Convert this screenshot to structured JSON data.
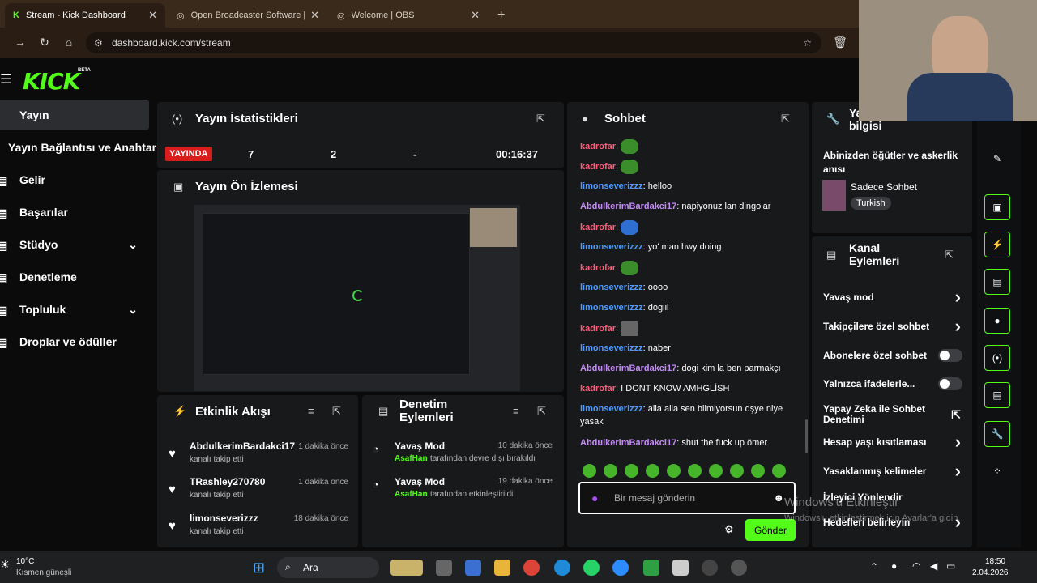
{
  "browser": {
    "tabs": [
      {
        "title": "Stream - Kick Dashboard",
        "active": true
      },
      {
        "title": "Open Broadcaster Software | OB",
        "active": false
      },
      {
        "title": "Welcome | OBS",
        "active": false
      }
    ],
    "url": "dashboard.kick.com/stream"
  },
  "header": {
    "logo": "KICK",
    "badge": "BETA"
  },
  "sidebar": {
    "items": [
      {
        "label": "Yayın",
        "active": true
      },
      {
        "label": "Yayın Bağlantısı ve Anahtarı"
      },
      {
        "label": "Gelir"
      },
      {
        "label": "Başarılar"
      },
      {
        "label": "Stüdyo",
        "expandable": true
      },
      {
        "label": "Denetleme"
      },
      {
        "label": "Topluluk",
        "expandable": true
      },
      {
        "label": "Droplar ve ödüller"
      }
    ]
  },
  "stats": {
    "title": "Yayın İstatistikleri",
    "live_label": "YAYINDA",
    "viewers": "7",
    "followers": "2",
    "subs": "-",
    "duration": "00:16:37"
  },
  "preview": {
    "title": "Yayın Ön İzlemesi"
  },
  "activity": {
    "title": "Etkinlik Akışı",
    "items": [
      {
        "name": "AbdulkerimBardakci17",
        "action": "kanalı takip etti",
        "time": "1 dakika önce"
      },
      {
        "name": "TRashley270780",
        "action": "kanalı takip etti",
        "time": "1 dakika önce"
      },
      {
        "name": "limonseverizzz",
        "action": "kanalı takip etti",
        "time": "18 dakika önce"
      }
    ]
  },
  "moderation": {
    "title": "Denetim Eylemleri",
    "items": [
      {
        "title": "Yavaş Mod",
        "user": "AsafHan",
        "action": "tarafından devre dışı bırakıldı",
        "time": "10 dakika önce"
      },
      {
        "title": "Yavaş Mod",
        "user": "AsafHan",
        "action": "tarafından etkinleştirildi",
        "time": "19 dakika önce"
      }
    ]
  },
  "chat": {
    "title": "Sohbet",
    "messages": [
      {
        "user": "kadrofar",
        "color": "red",
        "text": "",
        "emote": "green"
      },
      {
        "user": "kadrofar",
        "color": "red",
        "text": "",
        "emote": "green"
      },
      {
        "user": "limonseverizzz",
        "color": "blue",
        "text": "helloo"
      },
      {
        "user": "AbdulkerimBardakci17",
        "color": "purple",
        "text": "napiyonuz lan dingolar"
      },
      {
        "user": "kadrofar",
        "color": "red",
        "text": "",
        "emote": "blue"
      },
      {
        "user": "limonseverizzz",
        "color": "blue",
        "text": "yo' man hwy doing"
      },
      {
        "user": "kadrofar",
        "color": "red",
        "text": "",
        "emote": "green"
      },
      {
        "user": "limonseverizzz",
        "color": "blue",
        "text": "oooo"
      },
      {
        "user": "limonseverizzz",
        "color": "blue",
        "text": "dogiil"
      },
      {
        "user": "kadrofar",
        "color": "red",
        "text": "",
        "emote": "gray"
      },
      {
        "user": "limonseverizzz",
        "color": "blue",
        "text": "naber"
      },
      {
        "user": "AbdulkerimBardakci17",
        "color": "purple",
        "text": "dogi kim la ben parmakçı"
      },
      {
        "user": "kadrofar",
        "color": "red",
        "text": "I DONT KNOW AMHGLİSH"
      },
      {
        "user": "limonseverizzz",
        "color": "blue",
        "text": "alla alla sen bilmiyorsun dşye niye yasak"
      },
      {
        "user": "AbdulkerimBardakci17",
        "color": "purple",
        "text": "shut the fuck up ömer"
      }
    ],
    "input_placeholder": "Bir mesaj gönderin",
    "send_label": "Gönder"
  },
  "stream_info": {
    "title_line1": "Yayın",
    "title_line2": "bilgisi",
    "stream_title": "Abinizden öğütler ve askerlik anısı",
    "category": "Sadece Sohbet",
    "language": "Turkish"
  },
  "channel_actions": {
    "title_line1": "Kanal",
    "title_line2": "Eylemleri",
    "items": [
      {
        "label": "Yavaş mod",
        "type": "arrow"
      },
      {
        "label": "Takipçilere özel sohbet",
        "type": "arrow"
      },
      {
        "label": "Abonelere özel sohbet",
        "type": "toggle"
      },
      {
        "label": "Yalnızca ifadelerle...",
        "type": "toggle"
      },
      {
        "label": "Yapay Zeka ile Sohbet Denetimi",
        "type": "external"
      },
      {
        "label": "Hesap yaşı kısıtlaması",
        "type": "arrow"
      },
      {
        "label": "Yasaklanmış kelimeler",
        "type": "arrow"
      },
      {
        "label": "İzleyici Yönlendir",
        "type": "none"
      },
      {
        "label": "Hedefleri belirleyin",
        "type": "arrow"
      }
    ]
  },
  "watermark": {
    "line1": "Windows'u Etkinleştir",
    "line2": "Windows'u etkinleştirmek için Ayarlar'a gidin."
  },
  "taskbar": {
    "weather_temp": "10°C",
    "weather_desc": "Kısmen güneşli",
    "search_label": "Ara",
    "time": "18:50",
    "date": "2.04.2026"
  }
}
